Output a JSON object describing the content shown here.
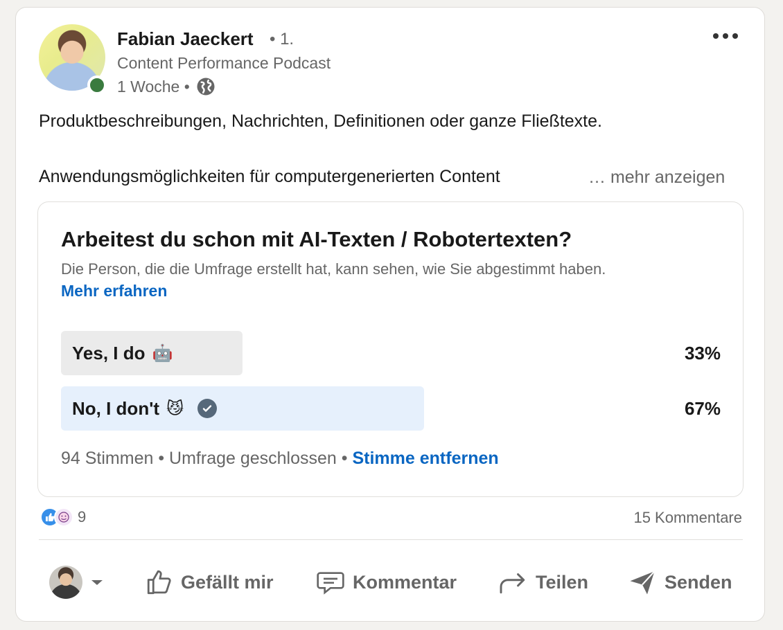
{
  "post": {
    "author_name": "Fabian Jaeckert",
    "degree": "• 1.",
    "subtitle": "Content Performance Podcast",
    "time": "1 Woche •",
    "body_line1": "Produktbeschreibungen, Nachrichten, Definitionen oder ganze Fließtexte.",
    "body_line2": "Anwendungsmöglichkeiten für computergenerierten Content",
    "see_more": "… mehr anzeigen"
  },
  "poll": {
    "question": "Arbeitest du schon mit AI-Texten / Robotertexten?",
    "note": "Die Person, die die Umfrage erstellt hat, kann sehen, wie Sie abgestimmt haben.",
    "learn_more": "Mehr erfahren",
    "options": [
      {
        "label": "Yes, I do",
        "emoji": "🤖",
        "percent_text": "33%",
        "share": 0.33,
        "selected": false
      },
      {
        "label": "No, I don't",
        "emoji": "😼",
        "percent_text": "67%",
        "share": 0.67,
        "selected": true
      }
    ],
    "votes": "94 Stimmen",
    "status": "• Umfrage geschlossen •",
    "remove_vote": "Stimme entfernen"
  },
  "social": {
    "reaction_count": "9",
    "comments": "15 Kommentare"
  },
  "actions": {
    "like": "Gefällt mir",
    "comment": "Kommentar",
    "share": "Teilen",
    "send": "Senden"
  },
  "colors": {
    "link": "#0a66c2",
    "bar_default": "#ebebeb",
    "bar_selected": "#e6f0fc",
    "presence": "#3a7b3f"
  }
}
